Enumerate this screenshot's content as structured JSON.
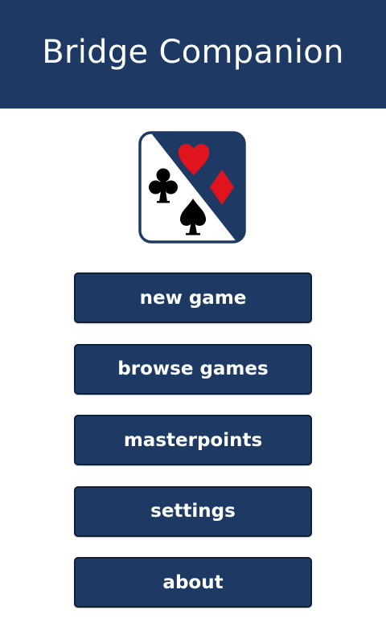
{
  "header": {
    "title": "Bridge Companion"
  },
  "logo": {
    "icon": "card-suits-logo-icon",
    "suits": [
      "club",
      "heart",
      "diamond",
      "spade"
    ],
    "colors": {
      "navy": "#1e3a64",
      "red": "#e0141e",
      "black": "#000000"
    }
  },
  "menu": {
    "items": [
      {
        "id": "new-game",
        "label": "new game"
      },
      {
        "id": "browse-games",
        "label": "browse games"
      },
      {
        "id": "masterpoints",
        "label": "masterpoints"
      },
      {
        "id": "settings",
        "label": "settings"
      },
      {
        "id": "about",
        "label": "about"
      }
    ]
  },
  "theme": {
    "primary": "#1e3a64",
    "background": "#ffffff",
    "text_on_primary": "#ffffff"
  }
}
